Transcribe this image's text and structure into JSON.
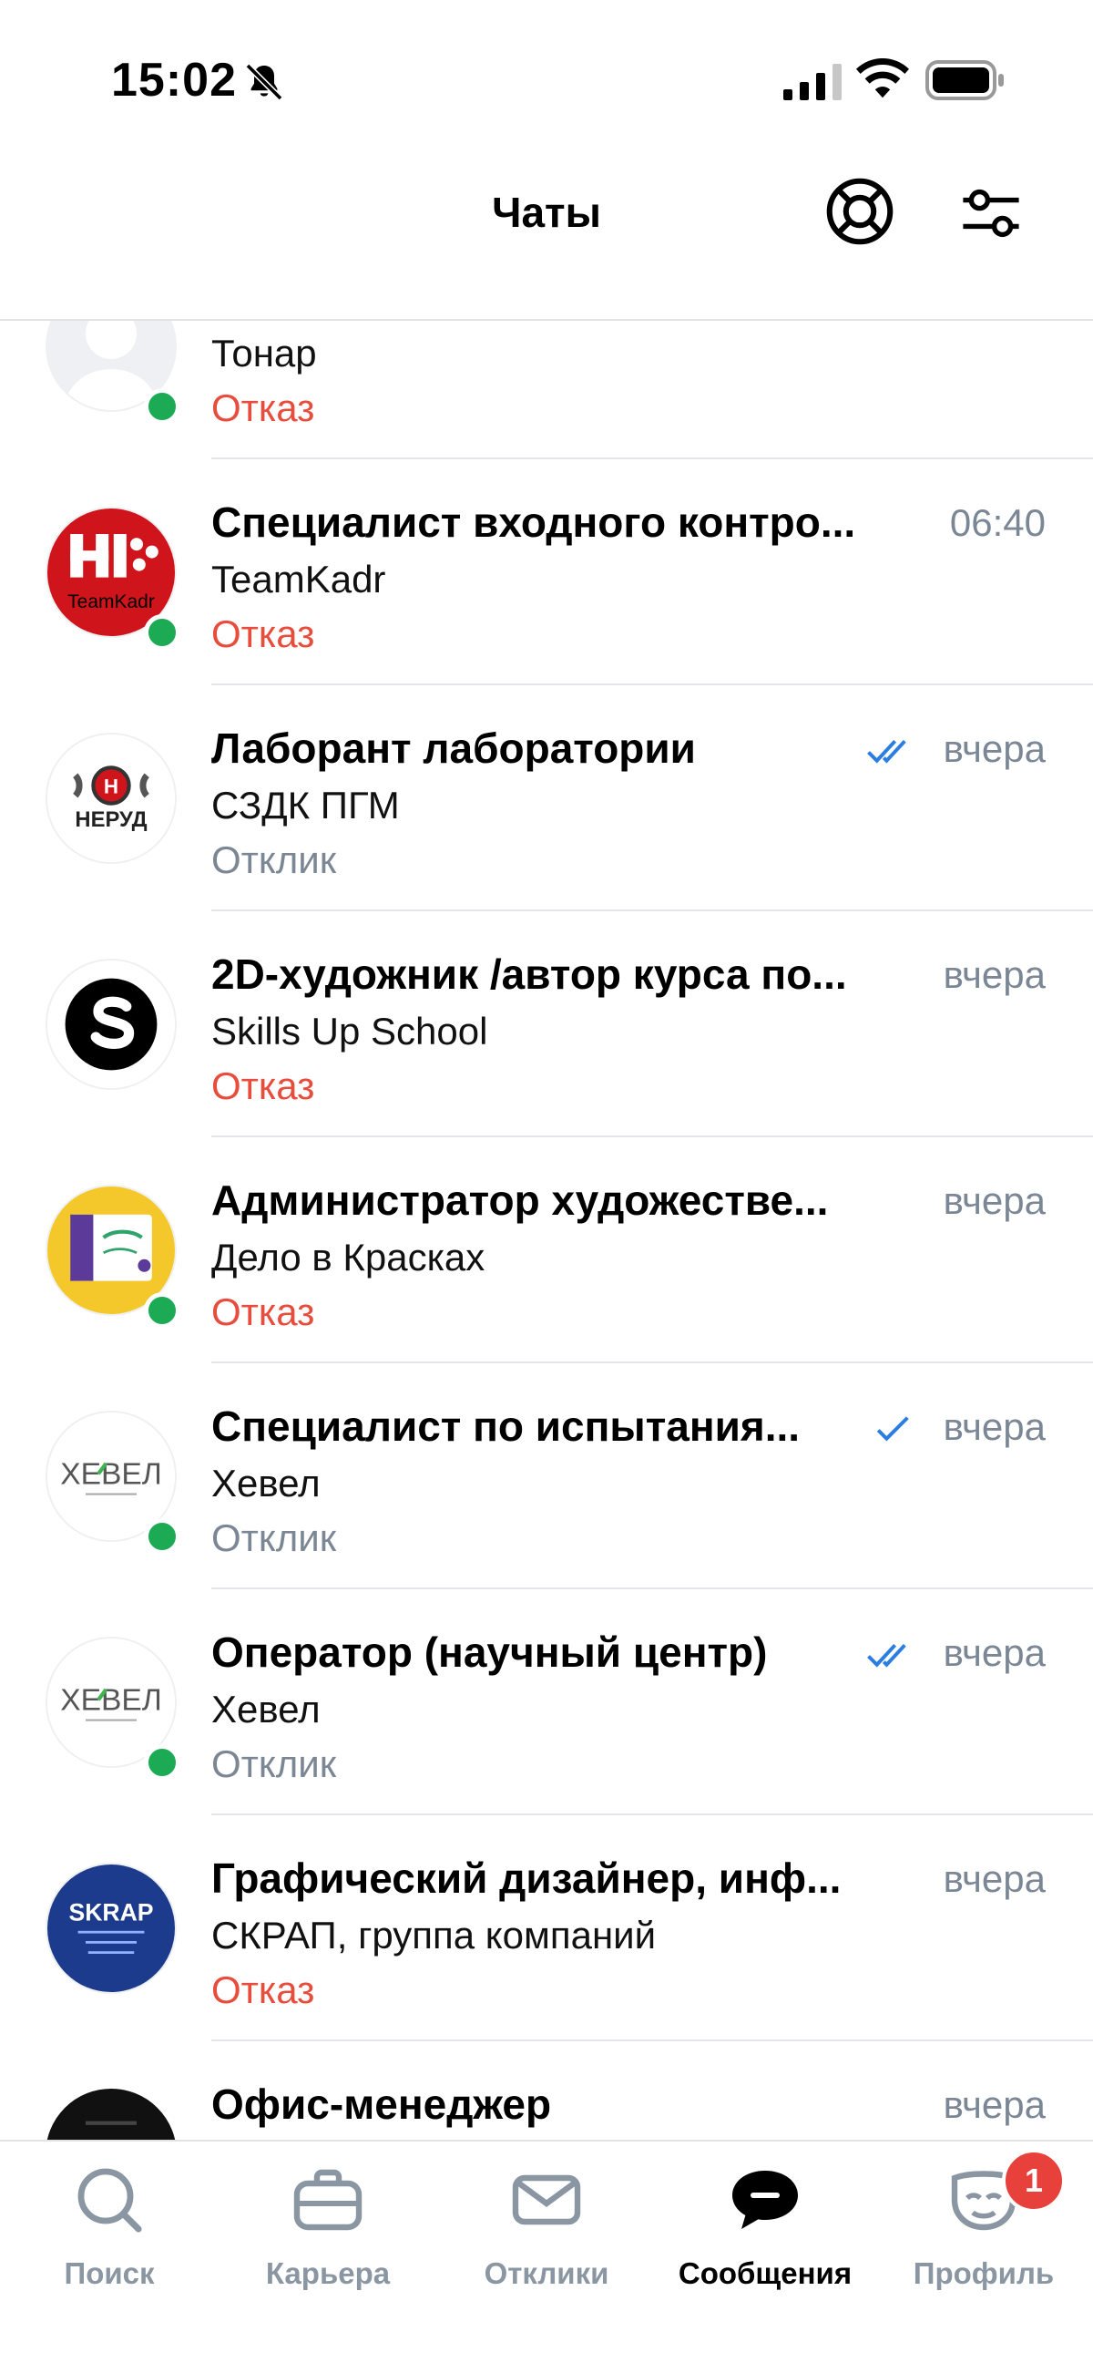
{
  "status_bar": {
    "time": "15:02"
  },
  "header": {
    "title": "Чаты"
  },
  "chats": [
    {
      "title": "",
      "company": "Тонар",
      "status": "Отказ",
      "status_type": "reject",
      "time": "",
      "check": "none",
      "online": true,
      "avatar": "person-placeholder"
    },
    {
      "title": "Специалист входного контро...",
      "company": "TeamKadr",
      "status": "Отказ",
      "status_type": "reject",
      "time": "06:40",
      "check": "none",
      "online": true,
      "avatar": "teamkadr-logo",
      "avatar_text": "TeamKadr"
    },
    {
      "title": "Лаборант лаборатории",
      "company": "СЗДК ПГМ",
      "status": "Отклик",
      "status_type": "response",
      "time": "вчера",
      "check": "double",
      "online": false,
      "avatar": "nerud-logo",
      "avatar_text": "НЕРУД"
    },
    {
      "title": "2D-художник /автор курса по...",
      "company": "Skills Up School",
      "status": "Отказ",
      "status_type": "reject",
      "time": "вчера",
      "check": "none",
      "online": false,
      "avatar": "skills-up-logo"
    },
    {
      "title": "Администратор художестве...",
      "company": "Дело в Красках",
      "status": "Отказ",
      "status_type": "reject",
      "time": "вчера",
      "check": "none",
      "online": true,
      "avatar": "delo-v-kraskah-logo"
    },
    {
      "title": "Специалист по испытания...",
      "company": "Хевел",
      "status": "Отклик",
      "status_type": "response",
      "time": "вчера",
      "check": "single",
      "online": true,
      "avatar": "hevel-logo",
      "avatar_text": "ХЕВЕЛ"
    },
    {
      "title": "Оператор (научный центр)",
      "company": "Хевел",
      "status": "Отклик",
      "status_type": "response",
      "time": "вчера",
      "check": "double",
      "online": true,
      "avatar": "hevel-logo",
      "avatar_text": "ХЕВЕЛ"
    },
    {
      "title": "Графический дизайнер, инф...",
      "company": "СКРАП, группа компаний",
      "status": "Отказ",
      "status_type": "reject",
      "time": "вчера",
      "check": "none",
      "online": false,
      "avatar": "skrap-logo",
      "avatar_text": "SKRAP"
    },
    {
      "title": "Офис-менеджер",
      "company": "",
      "status": "",
      "status_type": "none",
      "time": "вчера",
      "check": "none",
      "online": false,
      "avatar": "dark-logo"
    }
  ],
  "bottom_nav": [
    {
      "label": "Поиск",
      "icon": "search-icon",
      "active": false
    },
    {
      "label": "Карьера",
      "icon": "briefcase-icon",
      "active": false
    },
    {
      "label": "Отклики",
      "icon": "envelope-icon",
      "active": false
    },
    {
      "label": "Сообщения",
      "icon": "chat-bubble-icon",
      "active": true
    },
    {
      "label": "Профиль",
      "icon": "profile-mask-icon",
      "active": false,
      "badge": "1"
    }
  ],
  "colors": {
    "reject": "#e74c3c",
    "response": "#7b8794",
    "online": "#1daa55",
    "check": "#2a7de1",
    "badge": "#e8403a"
  }
}
